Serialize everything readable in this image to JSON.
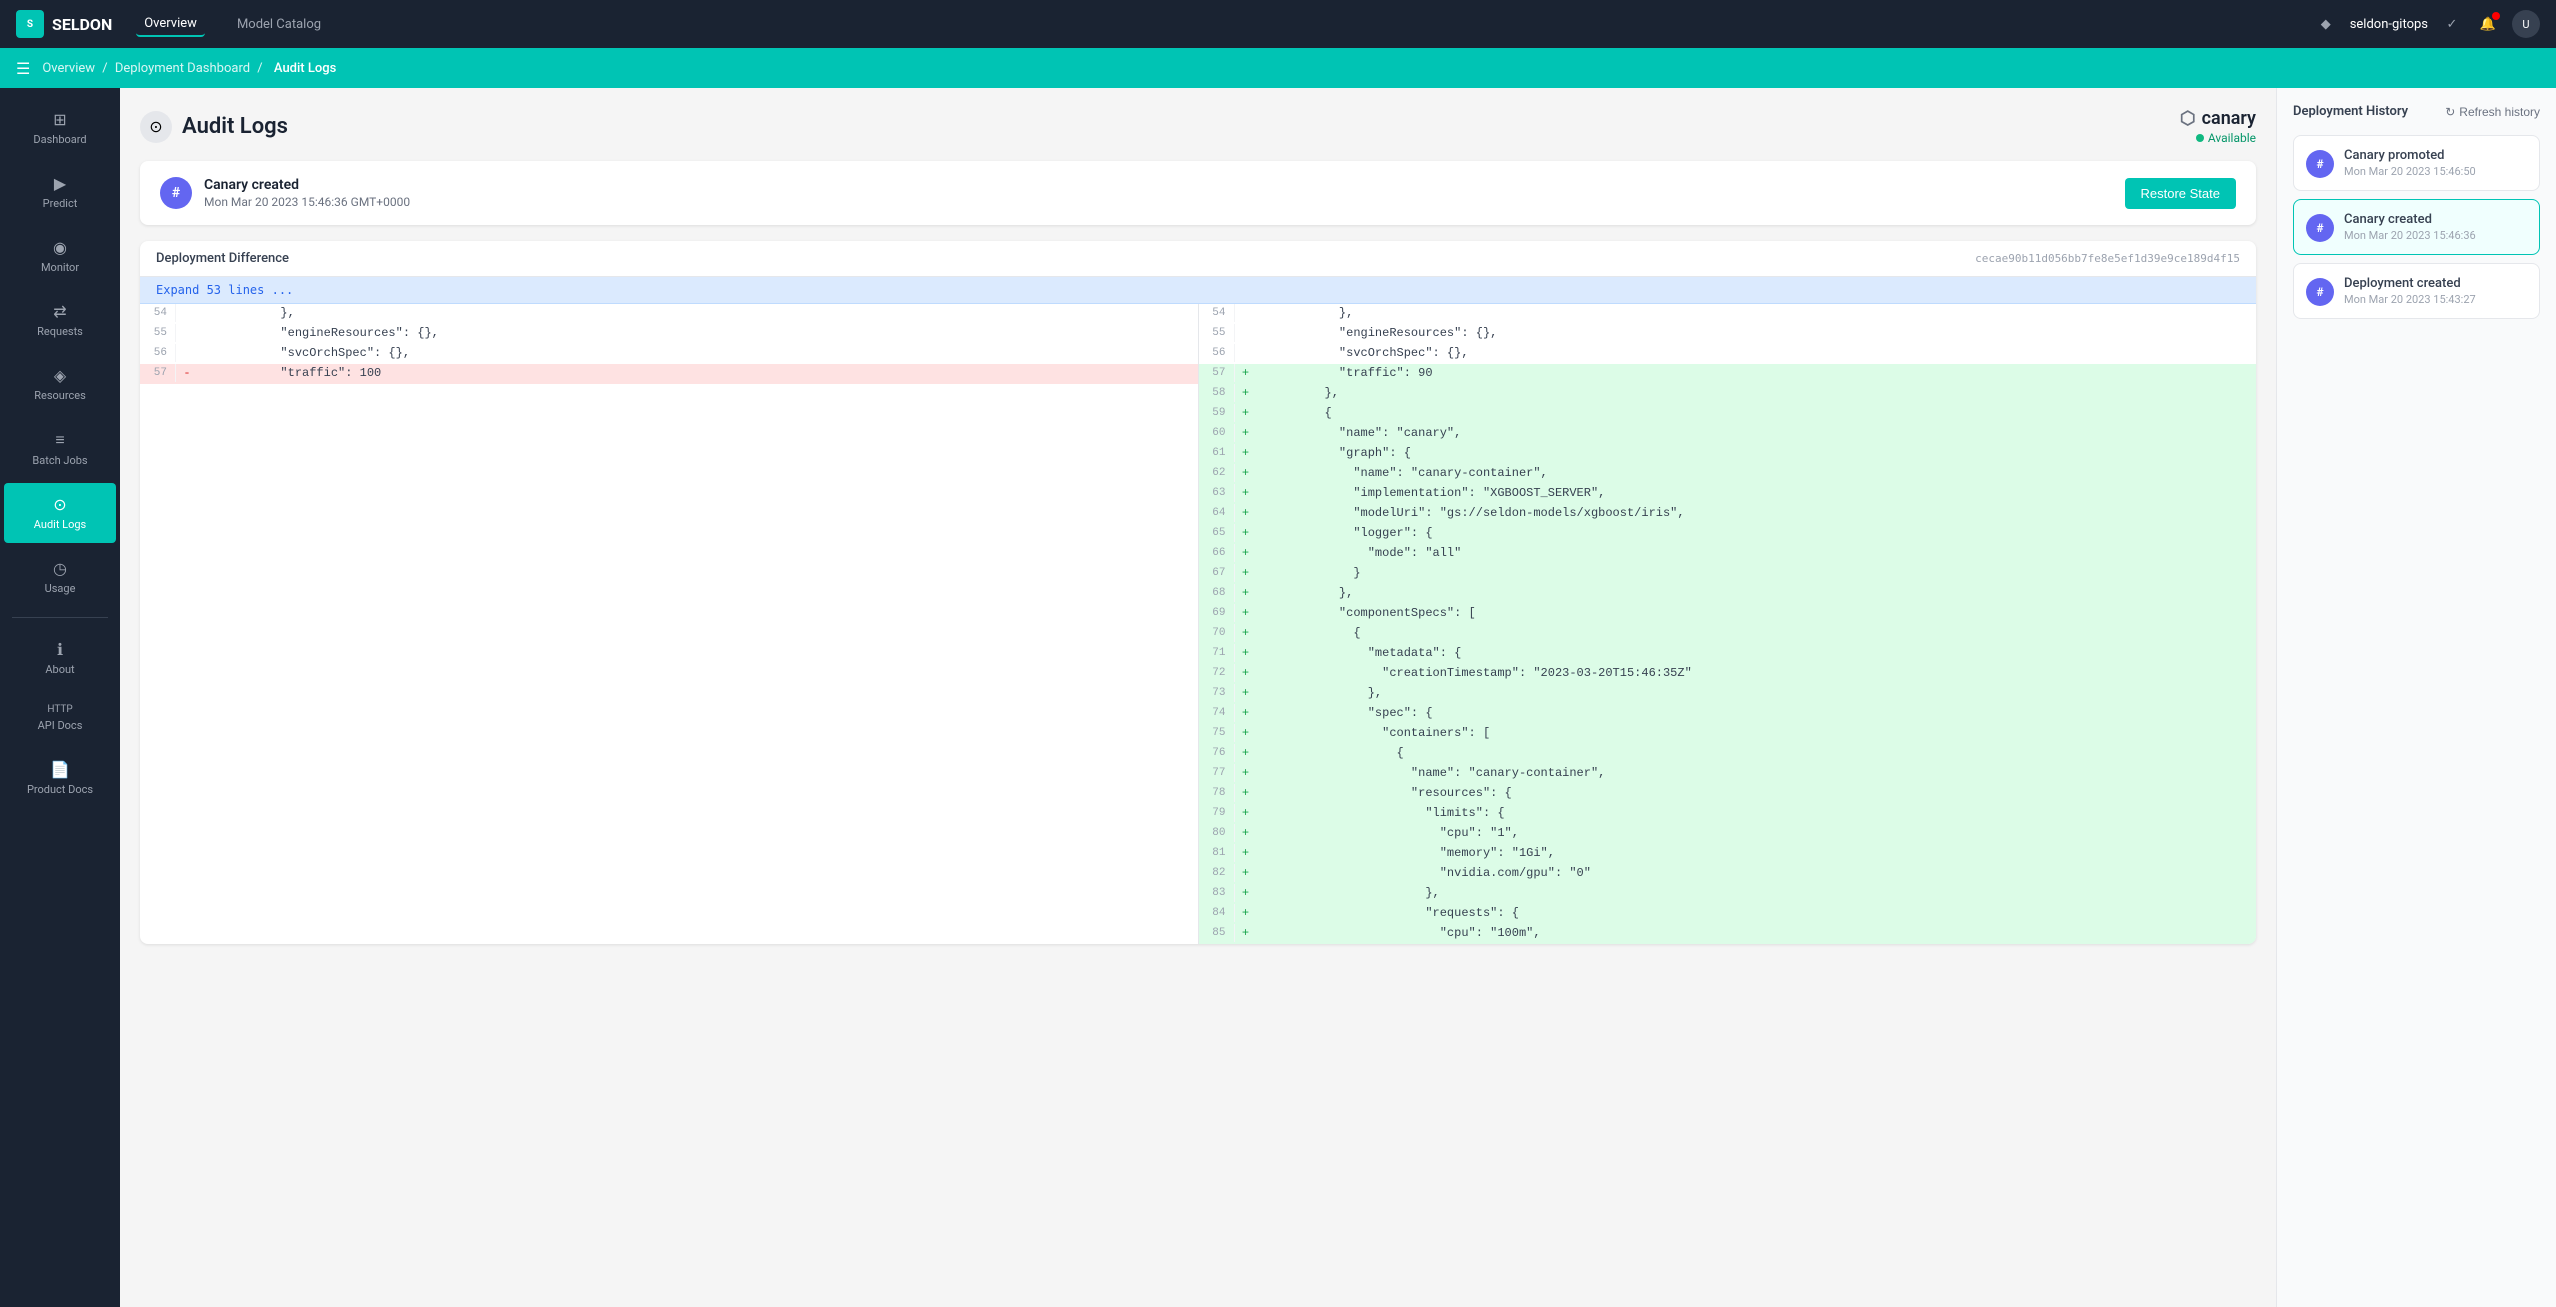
{
  "topNav": {
    "logo": "SELDON",
    "tabs": [
      {
        "label": "Overview",
        "active": true
      },
      {
        "label": "Model Catalog",
        "active": false
      }
    ],
    "user": "seldon-gitops"
  },
  "breadcrumb": {
    "items": [
      "Overview",
      "Deployment Dashboard",
      "Audit Logs"
    ]
  },
  "sidebar": {
    "items": [
      {
        "label": "Dashboard",
        "icon": "⊞",
        "active": false
      },
      {
        "label": "Predict",
        "icon": "▶",
        "active": false
      },
      {
        "label": "Monitor",
        "icon": "◉",
        "active": false
      },
      {
        "label": "Requests",
        "icon": "⇄",
        "active": false
      },
      {
        "label": "Resources",
        "icon": "◈",
        "active": false
      },
      {
        "label": "Batch Jobs",
        "icon": "≡",
        "active": false
      },
      {
        "label": "Audit Logs",
        "icon": "⊙",
        "active": true
      },
      {
        "label": "Usage",
        "icon": "◷",
        "active": false
      },
      {
        "label": "About",
        "icon": "ℹ",
        "active": false
      },
      {
        "label": "API Docs",
        "icon": "HTTP",
        "active": false
      },
      {
        "label": "Product Docs",
        "icon": "📄",
        "active": false
      }
    ]
  },
  "pageTitle": "Audit Logs",
  "deployment": {
    "name": "canary",
    "status": "Available"
  },
  "event": {
    "title": "Canary created",
    "time": "Mon Mar 20 2023 15:46:36 GMT+0000",
    "avatar": "#",
    "restoreLabel": "Restore State"
  },
  "diff": {
    "title": "Deployment Difference",
    "hash": "cecae90b11d056bb7fe8e5ef1d39e9ce189d4f15",
    "expandLabel": "Expand 53 lines ...",
    "leftLines": [
      {
        "num": 54,
        "type": "normal",
        "marker": "",
        "content": "            },"
      },
      {
        "num": 55,
        "type": "normal",
        "marker": "",
        "content": "            \"engineResources\": {},"
      },
      {
        "num": 56,
        "type": "normal",
        "marker": "",
        "content": "            \"svcOrchSpec\": {},"
      },
      {
        "num": 57,
        "type": "removed",
        "marker": "-",
        "content": "            \"traffic\": 100"
      }
    ],
    "rightLines": [
      {
        "num": 54,
        "type": "normal",
        "marker": "",
        "content": "            },"
      },
      {
        "num": 55,
        "type": "normal",
        "marker": "",
        "content": "            \"engineResources\": {},"
      },
      {
        "num": 56,
        "type": "normal",
        "marker": "",
        "content": "            \"svcOrchSpec\": {},"
      },
      {
        "num": 57,
        "type": "added",
        "marker": "+",
        "content": "            \"traffic\": 90"
      },
      {
        "num": 58,
        "type": "added",
        "marker": "+",
        "content": "          },"
      },
      {
        "num": 59,
        "type": "added",
        "marker": "+",
        "content": "          {"
      },
      {
        "num": 60,
        "type": "added",
        "marker": "+",
        "content": "            \"name\": \"canary\","
      },
      {
        "num": 61,
        "type": "added",
        "marker": "+",
        "content": "            \"graph\": {"
      },
      {
        "num": 62,
        "type": "added",
        "marker": "+",
        "content": "              \"name\": \"canary-container\","
      },
      {
        "num": 63,
        "type": "added",
        "marker": "+",
        "content": "              \"implementation\": \"XGBOOST_SERVER\","
      },
      {
        "num": 64,
        "type": "added",
        "marker": "+",
        "content": "              \"modelUri\": \"gs://seldon-models/xgboost/iris\","
      },
      {
        "num": 65,
        "type": "added",
        "marker": "+",
        "content": "              \"logger\": {"
      },
      {
        "num": 66,
        "type": "added",
        "marker": "+",
        "content": "                \"mode\": \"all\""
      },
      {
        "num": 67,
        "type": "added",
        "marker": "+",
        "content": "              }"
      },
      {
        "num": 68,
        "type": "added",
        "marker": "+",
        "content": "            },"
      },
      {
        "num": 69,
        "type": "added",
        "marker": "+",
        "content": "            \"componentSpecs\": ["
      },
      {
        "num": 70,
        "type": "added",
        "marker": "+",
        "content": "              {"
      },
      {
        "num": 71,
        "type": "added",
        "marker": "+",
        "content": "                \"metadata\": {"
      },
      {
        "num": 72,
        "type": "added",
        "marker": "+",
        "content": "                  \"creationTimestamp\": \"2023-03-20T15:46:35Z\""
      },
      {
        "num": 73,
        "type": "added",
        "marker": "+",
        "content": "                },"
      },
      {
        "num": 74,
        "type": "added",
        "marker": "+",
        "content": "                \"spec\": {"
      },
      {
        "num": 75,
        "type": "added",
        "marker": "+",
        "content": "                  \"containers\": ["
      },
      {
        "num": 76,
        "type": "added",
        "marker": "+",
        "content": "                    {"
      },
      {
        "num": 77,
        "type": "added",
        "marker": "+",
        "content": "                      \"name\": \"canary-container\","
      },
      {
        "num": 78,
        "type": "added",
        "marker": "+",
        "content": "                      \"resources\": {"
      },
      {
        "num": 79,
        "type": "added",
        "marker": "+",
        "content": "                        \"limits\": {"
      },
      {
        "num": 80,
        "type": "added",
        "marker": "+",
        "content": "                          \"cpu\": \"1\","
      },
      {
        "num": 81,
        "type": "added",
        "marker": "+",
        "content": "                          \"memory\": \"1Gi\","
      },
      {
        "num": 82,
        "type": "added",
        "marker": "+",
        "content": "                          \"nvidia.com/gpu\": \"0\""
      },
      {
        "num": 83,
        "type": "added",
        "marker": "+",
        "content": "                        },"
      },
      {
        "num": 84,
        "type": "added",
        "marker": "+",
        "content": "                        \"requests\": {"
      },
      {
        "num": 85,
        "type": "added",
        "marker": "+",
        "content": "                          \"cpu\": \"100m\","
      }
    ]
  },
  "history": {
    "title": "Deployment History",
    "refreshLabel": "Refresh history",
    "items": [
      {
        "title": "Canary promoted",
        "time": "Mon Mar 20 2023 15:46:50",
        "avatar": "#",
        "active": false
      },
      {
        "title": "Canary created",
        "time": "Mon Mar 20 2023 15:46:36",
        "avatar": "#",
        "active": true
      },
      {
        "title": "Deployment created",
        "time": "Mon Mar 20 2023 15:43:27",
        "avatar": "#",
        "active": false
      }
    ]
  }
}
